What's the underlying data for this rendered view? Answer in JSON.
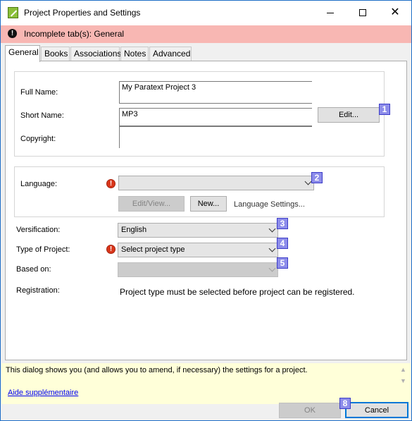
{
  "window": {
    "title": "Project Properties and Settings",
    "icon": "paratext-app-icon",
    "controls": {
      "minimize": "minimize-icon",
      "maximize": "maximize-icon",
      "close": "close-icon"
    }
  },
  "banner": {
    "text": "Incomplete tab(s): General",
    "icon": "exclamation-icon"
  },
  "tabs": [
    {
      "label": "General",
      "active": true
    },
    {
      "label": "Books"
    },
    {
      "label": "Associations"
    },
    {
      "label": "Notes"
    },
    {
      "label": "Advanced"
    }
  ],
  "general": {
    "full_name": {
      "label": "Full Name:",
      "value": "My Paratext Project 3"
    },
    "short_name": {
      "label": "Short Name:",
      "value": "MP3"
    },
    "edit_button": "Edit...",
    "copyright": {
      "label": "Copyright:",
      "value": ""
    },
    "language": {
      "label": "Language:",
      "value": "",
      "edit_view_button": "Edit/View...",
      "new_button": "New...",
      "settings_link": "Language Settings..."
    },
    "versification": {
      "label": "Versification:",
      "value": "English"
    },
    "project_type": {
      "label": "Type of Project:",
      "value": "Select project type"
    },
    "based_on": {
      "label": "Based on:",
      "value": ""
    },
    "registration": {
      "label": "Registration:",
      "message": "Project type must be selected before project can be registered."
    }
  },
  "markers": [
    "1",
    "2",
    "3",
    "4",
    "5",
    "8"
  ],
  "help": {
    "text": "This dialog shows you (and allows you to amend, if necessary) the settings for a project.",
    "link": "Aide supplémentaire"
  },
  "footer": {
    "ok_button": "OK",
    "cancel_button": "Cancel"
  },
  "colors": {
    "banner_bg": "#f8b7b3",
    "help_bg": "#ffffd9",
    "marker_bg": "#8d8dea",
    "accent": "#0078d7"
  }
}
